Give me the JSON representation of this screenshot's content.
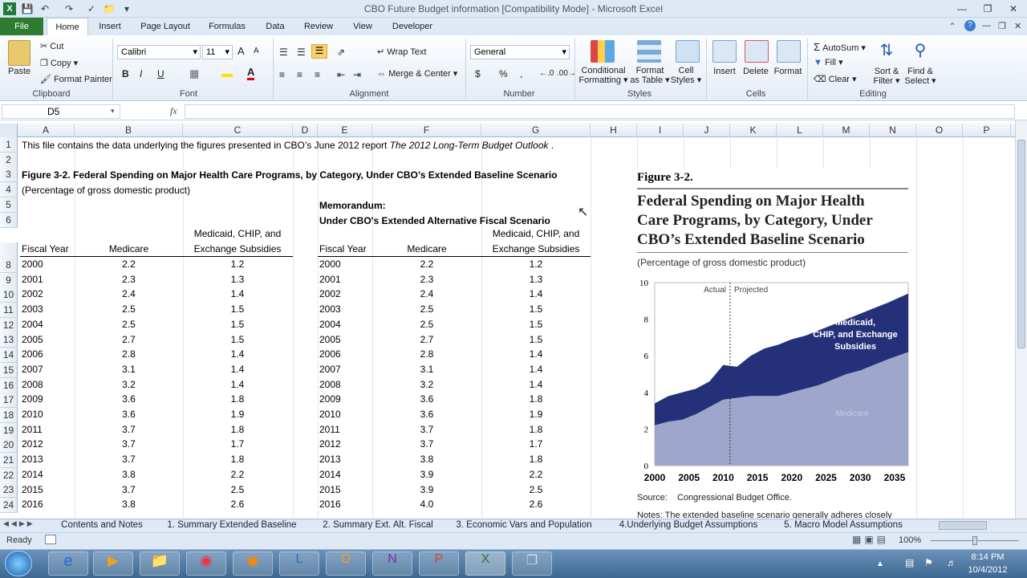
{
  "window": {
    "title": "CBO Future Budget information  [Compatibility Mode]  -  Microsoft Excel"
  },
  "ribbon_tabs": [
    "File",
    "Home",
    "Insert",
    "Page Layout",
    "Formulas",
    "Data",
    "Review",
    "View",
    "Developer"
  ],
  "clipboard": {
    "paste": "Paste",
    "cut": "Cut",
    "copy": "Copy",
    "format_painter": "Format Painter",
    "label": "Clipboard"
  },
  "font": {
    "name": "Calibri",
    "size": "11",
    "label": "Font",
    "bold": "B",
    "italic": "I",
    "underline": "U",
    "grow": "A",
    "shrink": "A"
  },
  "alignment": {
    "wrap_text": "Wrap Text",
    "merge_center": "Merge & Center",
    "label": "Alignment"
  },
  "number": {
    "format": "General",
    "currency": "$",
    "percent": "%",
    "comma": ",",
    "label": "Number"
  },
  "styles": {
    "conditional": "Conditional",
    "conditional2": "Formatting",
    "format_as": "Format",
    "format_as2": "as Table",
    "cell": "Cell",
    "cell2": "Styles",
    "label": "Styles"
  },
  "cells": {
    "insert": "Insert",
    "delete": "Delete",
    "format": "Format",
    "label": "Cells"
  },
  "editing": {
    "autosum": "AutoSum",
    "fill": "Fill",
    "clear": "Clear",
    "sort": "Sort &",
    "sort2": "Filter",
    "find": "Find &",
    "find2": "Select",
    "label": "Editing"
  },
  "formula_bar": {
    "name_box": "D5",
    "fx": "fx",
    "value": ""
  },
  "columns": [
    "A",
    "B",
    "C",
    "D",
    "E",
    "F",
    "G",
    "H",
    "I",
    "J",
    "K",
    "L",
    "M",
    "N",
    "O",
    "P"
  ],
  "rows": [
    "1",
    "2",
    "3",
    "4",
    "5",
    "6",
    "7",
    "8",
    "9",
    "10",
    "11",
    "12",
    "13",
    "14",
    "15",
    "16",
    "17",
    "18",
    "19",
    "20",
    "21",
    "22",
    "23",
    "24"
  ],
  "sheet": {
    "r1_prefix": "This file contains the data underlying the figures presented in CBO’s June 2012 report ",
    "r1_italic": "The 2012 Long-Term Budget Outlook",
    "r1_suffix": " .",
    "r3": "Figure 3-2. Federal Spending on Major Health Care Programs, by Category, Under CBO’s Extended Baseline Scenario",
    "r4": "(Percentage of gross domestic product)",
    "memo1": "Memorandum:",
    "memo2": "Under CBO's Extended Alternative Fiscal Scenario",
    "hdr_year": "Fiscal Year",
    "hdr_medicare": "Medicare",
    "hdr_medicaid1": "Medicaid, CHIP, and",
    "hdr_medicaid2": "Exchange Subsidies",
    "baseline": [
      [
        "2000",
        "2.2",
        "1.2"
      ],
      [
        "2001",
        "2.3",
        "1.3"
      ],
      [
        "2002",
        "2.4",
        "1.4"
      ],
      [
        "2003",
        "2.5",
        "1.5"
      ],
      [
        "2004",
        "2.5",
        "1.5"
      ],
      [
        "2005",
        "2.7",
        "1.5"
      ],
      [
        "2006",
        "2.8",
        "1.4"
      ],
      [
        "2007",
        "3.1",
        "1.4"
      ],
      [
        "2008",
        "3.2",
        "1.4"
      ],
      [
        "2009",
        "3.6",
        "1.8"
      ],
      [
        "2010",
        "3.6",
        "1.9"
      ],
      [
        "2011",
        "3.7",
        "1.8"
      ],
      [
        "2012",
        "3.7",
        "1.7"
      ],
      [
        "2013",
        "3.7",
        "1.8"
      ],
      [
        "2014",
        "3.8",
        "2.2"
      ],
      [
        "2015",
        "3.7",
        "2.5"
      ],
      [
        "2016",
        "3.8",
        "2.6"
      ]
    ],
    "alternative": [
      [
        "2000",
        "2.2",
        "1.2"
      ],
      [
        "2001",
        "2.3",
        "1.3"
      ],
      [
        "2002",
        "2.4",
        "1.4"
      ],
      [
        "2003",
        "2.5",
        "1.5"
      ],
      [
        "2004",
        "2.5",
        "1.5"
      ],
      [
        "2005",
        "2.7",
        "1.5"
      ],
      [
        "2006",
        "2.8",
        "1.4"
      ],
      [
        "2007",
        "3.1",
        "1.4"
      ],
      [
        "2008",
        "3.2",
        "1.4"
      ],
      [
        "2009",
        "3.6",
        "1.8"
      ],
      [
        "2010",
        "3.6",
        "1.9"
      ],
      [
        "2011",
        "3.7",
        "1.8"
      ],
      [
        "2012",
        "3.7",
        "1.7"
      ],
      [
        "2013",
        "3.8",
        "1.8"
      ],
      [
        "2014",
        "3.9",
        "2.2"
      ],
      [
        "2015",
        "3.9",
        "2.5"
      ],
      [
        "2016",
        "4.0",
        "2.6"
      ]
    ]
  },
  "figure": {
    "label": "Figure 3-2.",
    "title1": "Federal Spending on Major Health",
    "title2": "Care Programs, by Category, Under",
    "title3": "CBO’s Extended Baseline Scenario",
    "subtitle": "(Percentage of gross domestic product)",
    "actual": "Actual",
    "projected": "Projected",
    "medicaid1": "Medicaid,",
    "medicaid2": "CHIP, and Exchange",
    "medicaid3": "Subsidies",
    "medicare": "Medicare",
    "source_label": "Source:",
    "source": "Congressional Budget Office.",
    "notes": "Notes:  The extended baseline scenario generally adheres closely"
  },
  "chart_data": {
    "type": "area",
    "title": "Federal Spending on Major Health Care Programs, by Category, Under CBO’s Extended Baseline Scenario",
    "subtitle": "(Percentage of gross domestic product)",
    "x": [
      2000,
      2002,
      2004,
      2006,
      2008,
      2010,
      2012,
      2014,
      2016,
      2018,
      2020,
      2022,
      2024,
      2026,
      2028,
      2030,
      2032,
      2034,
      2037
    ],
    "series": [
      {
        "name": "Medicare",
        "values": [
          2.2,
          2.4,
          2.5,
          2.8,
          3.2,
          3.6,
          3.7,
          3.8,
          3.8,
          3.8,
          4.0,
          4.2,
          4.4,
          4.7,
          5.0,
          5.2,
          5.5,
          5.8,
          6.2
        ]
      },
      {
        "name": "Medicaid, CHIP, and Exchange Subsidies",
        "values": [
          1.2,
          1.4,
          1.5,
          1.4,
          1.4,
          1.9,
          1.7,
          2.2,
          2.6,
          2.8,
          2.9,
          2.9,
          3.0,
          3.0,
          3.0,
          3.1,
          3.1,
          3.1,
          3.2
        ]
      }
    ],
    "xticks": [
      "2000",
      "2005",
      "2010",
      "2015",
      "2020",
      "2025",
      "2030",
      "2035"
    ],
    "yticks": [
      "0",
      "2",
      "4",
      "6",
      "8",
      "10"
    ],
    "ylim": [
      0,
      10
    ],
    "divider_x": 2011,
    "colors": {
      "medicare": "#9fa6cc",
      "medicaid": "#24317a"
    }
  },
  "sheet_tabs": [
    "Contents and Notes",
    "1. Summary Extended Baseline",
    "2. Summary Ext. Alt. Fiscal",
    "3. Economic Vars and Population",
    "4.Underlying Budget Assumptions",
    "5. Macro Model Assumptions"
  ],
  "status": {
    "ready": "Ready",
    "zoom": "100%"
  },
  "taskbar": {
    "time": "8:14 PM",
    "date": "10/4/2012"
  }
}
